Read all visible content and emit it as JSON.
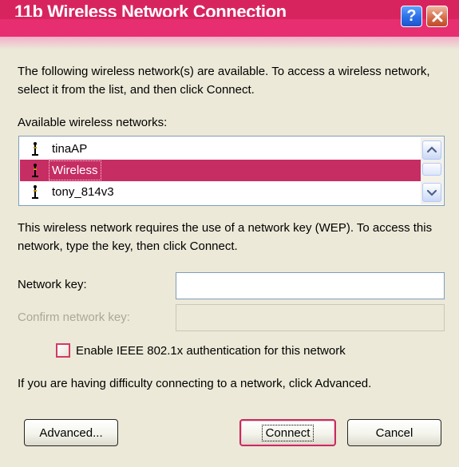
{
  "window": {
    "title": "11b Wireless Network Connection",
    "help_label": "?",
    "accent_color": "#d7245f",
    "selection_color": "#c62d63"
  },
  "intro": {
    "text": "The following wireless network(s) are available. To access a wireless network, select it from the list, and then click Connect."
  },
  "networks": {
    "label": "Available wireless networks:",
    "items": [
      {
        "label": "tinaAP",
        "selected": false
      },
      {
        "label": "Wireless",
        "selected": true
      },
      {
        "label": "tony_814v3",
        "selected": false
      }
    ]
  },
  "security": {
    "text": "This wireless network requires the use of a network key (WEP). To access this network, type the key, then click Connect."
  },
  "fields": {
    "network_key_label": "Network key:",
    "network_key_value": "",
    "confirm_key_label": "Confirm network key:",
    "confirm_key_value": ""
  },
  "auth": {
    "checkbox_label": "Enable IEEE 802.1x authentication for this network",
    "checked": false
  },
  "help": {
    "text": "If you are having difficulty connecting to a network, click Advanced."
  },
  "buttons": {
    "advanced": "Advanced...",
    "connect": "Connect",
    "cancel": "Cancel"
  }
}
